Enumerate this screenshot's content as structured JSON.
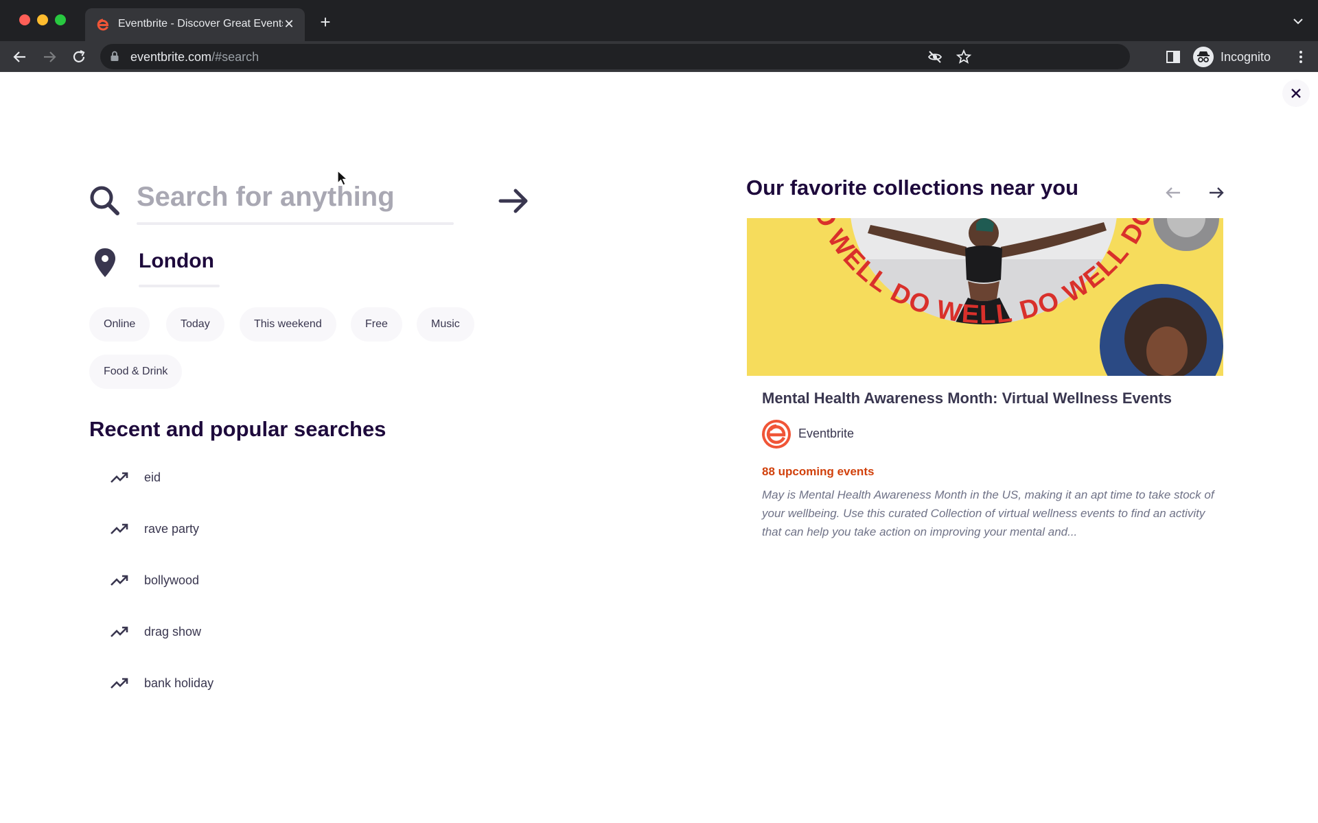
{
  "browser": {
    "tab_title": "Eventbrite - Discover Great Events",
    "url_domain": "eventbrite.com",
    "url_path": "/#search",
    "profile_label": "Incognito"
  },
  "search": {
    "placeholder": "Search for anything",
    "location": "London"
  },
  "chips": [
    "Online",
    "Today",
    "This weekend",
    "Free",
    "Music",
    "Food & Drink"
  ],
  "recent": {
    "title": "Recent and popular searches",
    "items": [
      "eid",
      "rave party",
      "bollywood",
      "drag show",
      "bank holiday"
    ]
  },
  "collections": {
    "title": "Our favorite collections near you",
    "card": {
      "title": "Mental Health Awareness Month: Virtual Wellness Events",
      "organizer": "Eventbrite",
      "upcoming": "88 upcoming events",
      "description": "May is Mental Health Awareness Month in the US, making it an apt time to take stock of your wellbeing. Use this curated Collection of virtual wellness events to find an activity that can help you take action on improving your mental and...",
      "banner_text": "DO WELL DO WELL DO WELL DO WELL DO WELL DO WELL DO WELL"
    }
  },
  "colors": {
    "brand": "#d1410c",
    "banner_yellow": "#f6dc5c",
    "text_dark": "#1e0a3c"
  },
  "icons": {
    "search": "search-icon",
    "location": "map-pin-icon",
    "trend": "trending-up-icon",
    "arrow": "arrow-right-icon",
    "close": "close-icon"
  }
}
